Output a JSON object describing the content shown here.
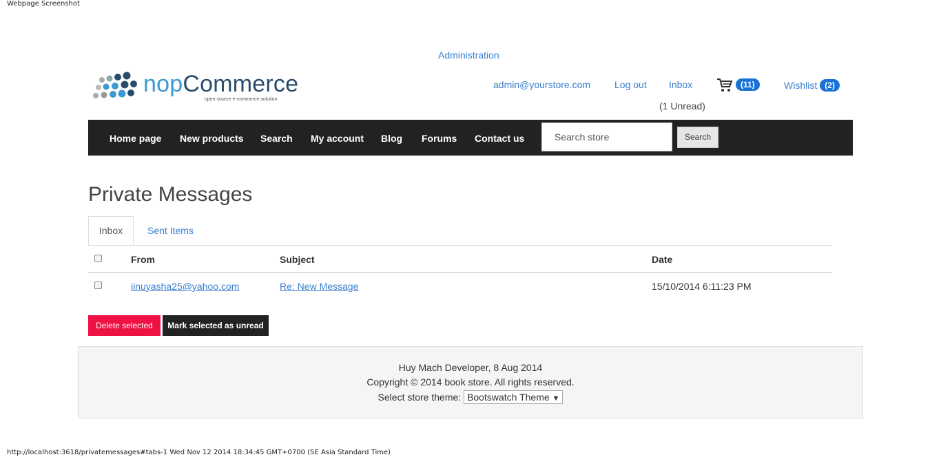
{
  "caption": "Webpage Screenshot",
  "status_url": "http://localhost:3618/privatemessages#tabs-1 Wed Nov 12 2014 18:34:45 GMT+0700 (SE Asia Standard Time)",
  "header": {
    "admin_link": "Administration",
    "logo": {
      "main_nop": "nop",
      "main_rest": "Commerce",
      "tagline": "open source e-commerce solution"
    },
    "account_email": "admin@yourstore.com",
    "logout": "Log out",
    "inbox": "Inbox",
    "inbox_unread": "(1 Unread)",
    "cart_count": "(11)",
    "wishlist": "Wishlist",
    "wishlist_count": "(2)"
  },
  "nav": {
    "items": [
      "Home page",
      "New products",
      "Search",
      "My account",
      "Blog",
      "Forums",
      "Contact us"
    ],
    "search_placeholder": "Search store",
    "search_button": "Search"
  },
  "page": {
    "title": "Private Messages",
    "tabs": [
      "Inbox",
      "Sent Items"
    ],
    "table": {
      "headers": [
        "From",
        "Subject",
        "Date"
      ],
      "rows": [
        {
          "from": "iinuyasha25@yahoo.com",
          "subject": "Re: New Message",
          "date": "15/10/2014 6:11:23 PM"
        }
      ]
    },
    "delete_button": "Delete selected",
    "mark_unread_button": "Mark selected as unread"
  },
  "footer": {
    "line1": "Huy Mach Developer, 8 Aug 2014",
    "line2": "Copyright © 2014 book store. All rights reserved.",
    "theme_label": "Select store theme:",
    "theme_value": "Bootswatch Theme"
  },
  "colors": {
    "link": "#3a7fcf",
    "badge": "#1a72d6",
    "navbar": "#222222",
    "delete": "#ee1144"
  }
}
